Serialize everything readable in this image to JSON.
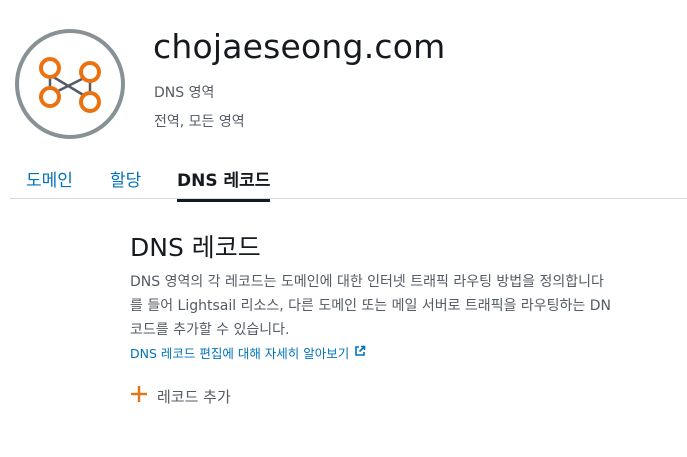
{
  "header": {
    "zone_icon": "dns-zone-icon",
    "title": "chojaeseong.com",
    "zone_type": "DNS 영역",
    "region": "전역, 모든 영역"
  },
  "tabs": [
    {
      "label": "도메인",
      "active": false
    },
    {
      "label": "할당",
      "active": false
    },
    {
      "label": "DNS 레코드",
      "active": true
    }
  ],
  "content": {
    "section_title": "DNS 레코드",
    "description_lines": [
      "DNS 영역의 각 레코드는 도메인에 대한 인터넷 트래픽 라우팅 방법을 정의합니다",
      "를 들어 Lightsail 리소스, 다른 도메인 또는 메일 서버로 트래픽을 라우팅하는 DN",
      "코드를 추가할 수 있습니다."
    ],
    "learn_more_link": "DNS 레코드 편집에 대해 자세히 알아보기",
    "add_record_label": "레코드 추가"
  },
  "colors": {
    "accent_orange": "#ec7211",
    "link_blue": "#0073bb",
    "icon_ring": "#879196"
  }
}
